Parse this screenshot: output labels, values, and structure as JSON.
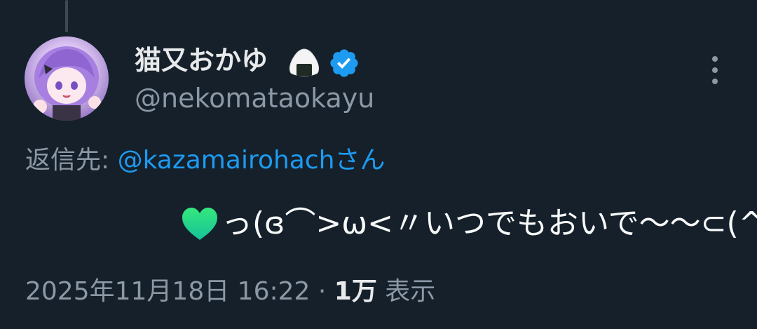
{
  "author": {
    "display_name": "猫又おかゆ",
    "name_emoji": "onigiri-emoji",
    "verified_badge": "verified-icon",
    "handle": "@nekomataokayu"
  },
  "menu_icon": "more-vertical-icon",
  "reply": {
    "prefix": "返信先: ",
    "mention": "@kazamairohachさん"
  },
  "tweet": {
    "emoji": "green-heart-emoji",
    "text": "っ(ɞ⌒>ω<〃いつでもおいで〜〜⊂(^"
  },
  "meta": {
    "timestamp": "2025年11月18日 16:22",
    "separator": " · ",
    "views_count": "1万",
    "views_label": " 表示"
  },
  "colors": {
    "background": "#15202b",
    "primary_text": "#e7e9ea",
    "secondary_text": "#8b98a5",
    "link": "#1d9bf0",
    "verified": "#1d9bf0",
    "heart": "#2ee078"
  }
}
